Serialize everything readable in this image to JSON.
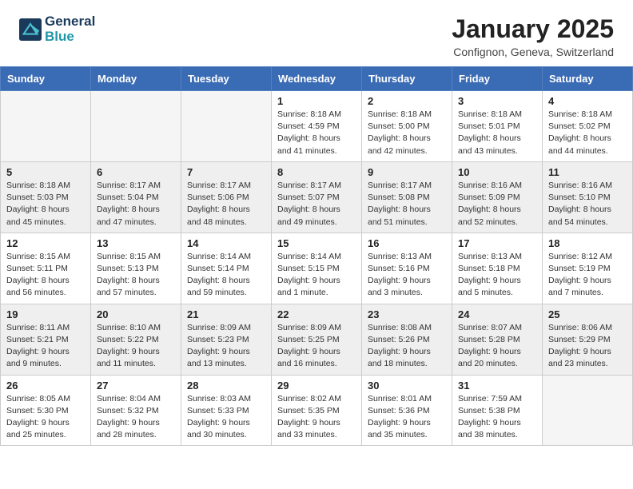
{
  "header": {
    "logo_line1": "General",
    "logo_line2": "Blue",
    "month": "January 2025",
    "location": "Confignon, Geneva, Switzerland"
  },
  "weekdays": [
    "Sunday",
    "Monday",
    "Tuesday",
    "Wednesday",
    "Thursday",
    "Friday",
    "Saturday"
  ],
  "weeks": [
    [
      {
        "day": "",
        "empty": true
      },
      {
        "day": "",
        "empty": true
      },
      {
        "day": "",
        "empty": true
      },
      {
        "day": "1",
        "sunrise": "8:18 AM",
        "sunset": "4:59 PM",
        "daylight": "8 hours and 41 minutes."
      },
      {
        "day": "2",
        "sunrise": "8:18 AM",
        "sunset": "5:00 PM",
        "daylight": "8 hours and 42 minutes."
      },
      {
        "day": "3",
        "sunrise": "8:18 AM",
        "sunset": "5:01 PM",
        "daylight": "8 hours and 43 minutes."
      },
      {
        "day": "4",
        "sunrise": "8:18 AM",
        "sunset": "5:02 PM",
        "daylight": "8 hours and 44 minutes."
      }
    ],
    [
      {
        "day": "5",
        "sunrise": "8:18 AM",
        "sunset": "5:03 PM",
        "daylight": "8 hours and 45 minutes."
      },
      {
        "day": "6",
        "sunrise": "8:17 AM",
        "sunset": "5:04 PM",
        "daylight": "8 hours and 47 minutes."
      },
      {
        "day": "7",
        "sunrise": "8:17 AM",
        "sunset": "5:06 PM",
        "daylight": "8 hours and 48 minutes."
      },
      {
        "day": "8",
        "sunrise": "8:17 AM",
        "sunset": "5:07 PM",
        "daylight": "8 hours and 49 minutes."
      },
      {
        "day": "9",
        "sunrise": "8:17 AM",
        "sunset": "5:08 PM",
        "daylight": "8 hours and 51 minutes."
      },
      {
        "day": "10",
        "sunrise": "8:16 AM",
        "sunset": "5:09 PM",
        "daylight": "8 hours and 52 minutes."
      },
      {
        "day": "11",
        "sunrise": "8:16 AM",
        "sunset": "5:10 PM",
        "daylight": "8 hours and 54 minutes."
      }
    ],
    [
      {
        "day": "12",
        "sunrise": "8:15 AM",
        "sunset": "5:11 PM",
        "daylight": "8 hours and 56 minutes."
      },
      {
        "day": "13",
        "sunrise": "8:15 AM",
        "sunset": "5:13 PM",
        "daylight": "8 hours and 57 minutes."
      },
      {
        "day": "14",
        "sunrise": "8:14 AM",
        "sunset": "5:14 PM",
        "daylight": "8 hours and 59 minutes."
      },
      {
        "day": "15",
        "sunrise": "8:14 AM",
        "sunset": "5:15 PM",
        "daylight": "9 hours and 1 minute."
      },
      {
        "day": "16",
        "sunrise": "8:13 AM",
        "sunset": "5:16 PM",
        "daylight": "9 hours and 3 minutes."
      },
      {
        "day": "17",
        "sunrise": "8:13 AM",
        "sunset": "5:18 PM",
        "daylight": "9 hours and 5 minutes."
      },
      {
        "day": "18",
        "sunrise": "8:12 AM",
        "sunset": "5:19 PM",
        "daylight": "9 hours and 7 minutes."
      }
    ],
    [
      {
        "day": "19",
        "sunrise": "8:11 AM",
        "sunset": "5:21 PM",
        "daylight": "9 hours and 9 minutes."
      },
      {
        "day": "20",
        "sunrise": "8:10 AM",
        "sunset": "5:22 PM",
        "daylight": "9 hours and 11 minutes."
      },
      {
        "day": "21",
        "sunrise": "8:09 AM",
        "sunset": "5:23 PM",
        "daylight": "9 hours and 13 minutes."
      },
      {
        "day": "22",
        "sunrise": "8:09 AM",
        "sunset": "5:25 PM",
        "daylight": "9 hours and 16 minutes."
      },
      {
        "day": "23",
        "sunrise": "8:08 AM",
        "sunset": "5:26 PM",
        "daylight": "9 hours and 18 minutes."
      },
      {
        "day": "24",
        "sunrise": "8:07 AM",
        "sunset": "5:28 PM",
        "daylight": "9 hours and 20 minutes."
      },
      {
        "day": "25",
        "sunrise": "8:06 AM",
        "sunset": "5:29 PM",
        "daylight": "9 hours and 23 minutes."
      }
    ],
    [
      {
        "day": "26",
        "sunrise": "8:05 AM",
        "sunset": "5:30 PM",
        "daylight": "9 hours and 25 minutes."
      },
      {
        "day": "27",
        "sunrise": "8:04 AM",
        "sunset": "5:32 PM",
        "daylight": "9 hours and 28 minutes."
      },
      {
        "day": "28",
        "sunrise": "8:03 AM",
        "sunset": "5:33 PM",
        "daylight": "9 hours and 30 minutes."
      },
      {
        "day": "29",
        "sunrise": "8:02 AM",
        "sunset": "5:35 PM",
        "daylight": "9 hours and 33 minutes."
      },
      {
        "day": "30",
        "sunrise": "8:01 AM",
        "sunset": "5:36 PM",
        "daylight": "9 hours and 35 minutes."
      },
      {
        "day": "31",
        "sunrise": "7:59 AM",
        "sunset": "5:38 PM",
        "daylight": "9 hours and 38 minutes."
      },
      {
        "day": "",
        "empty": true
      }
    ]
  ]
}
